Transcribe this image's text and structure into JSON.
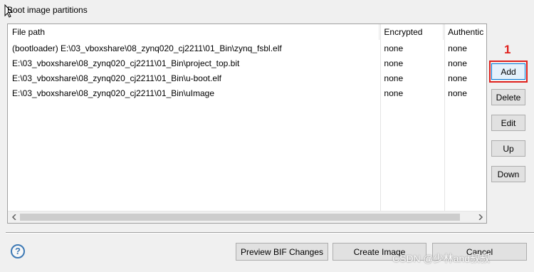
{
  "section": {
    "title": "Boot image partitions"
  },
  "table": {
    "columns": [
      "File path",
      "Encrypted",
      "Authentic"
    ],
    "rows": [
      {
        "path": "(bootloader) E:\\03_vboxshare\\08_zynq020_cj2211\\01_Bin\\zynq_fsbl.elf",
        "encrypted": "none",
        "authentication": "none"
      },
      {
        "path": "E:\\03_vboxshare\\08_zynq020_cj2211\\01_Bin\\project_top.bit",
        "encrypted": "none",
        "authentication": "none"
      },
      {
        "path": "E:\\03_vboxshare\\08_zynq020_cj2211\\01_Bin\\u-boot.elf",
        "encrypted": "none",
        "authentication": "none"
      },
      {
        "path": "E:\\03_vboxshare\\08_zynq020_cj2211\\01_Bin\\uImage",
        "encrypted": "none",
        "authentication": "none"
      }
    ]
  },
  "side_buttons": {
    "add": "Add",
    "delete": "Delete",
    "edit": "Edit",
    "up": "Up",
    "down": "Down"
  },
  "annotation": {
    "number": "1",
    "color": "#e0201c"
  },
  "footer": {
    "help": "?",
    "preview": "Preview BIF Changes",
    "create": "Create Image",
    "cancel": "Cancel"
  },
  "watermark": "CSDN @少林and叔叔"
}
